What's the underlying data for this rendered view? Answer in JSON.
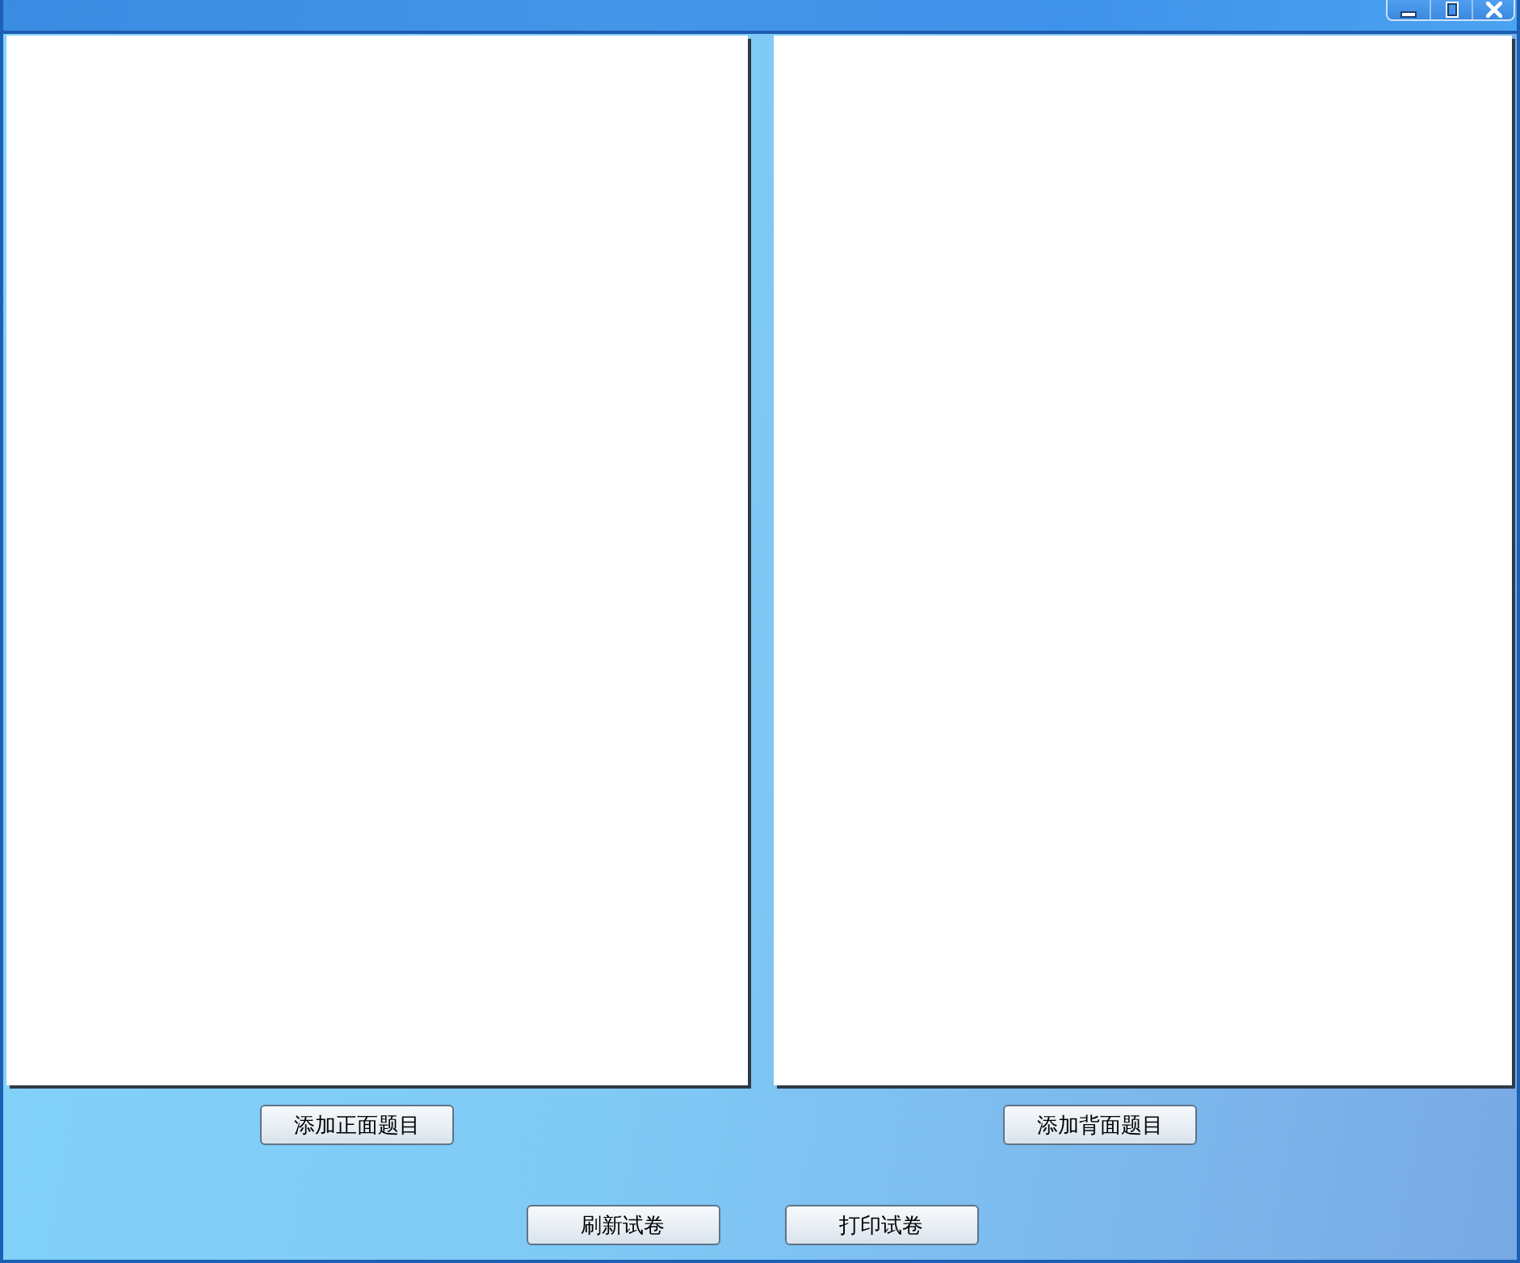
{
  "front_page": {
    "add_button": "添加正面题目"
  },
  "back_page": {
    "add_button": "添加背面题目"
  },
  "refresh_button": "刷新试卷",
  "print_button": "打印试卷"
}
